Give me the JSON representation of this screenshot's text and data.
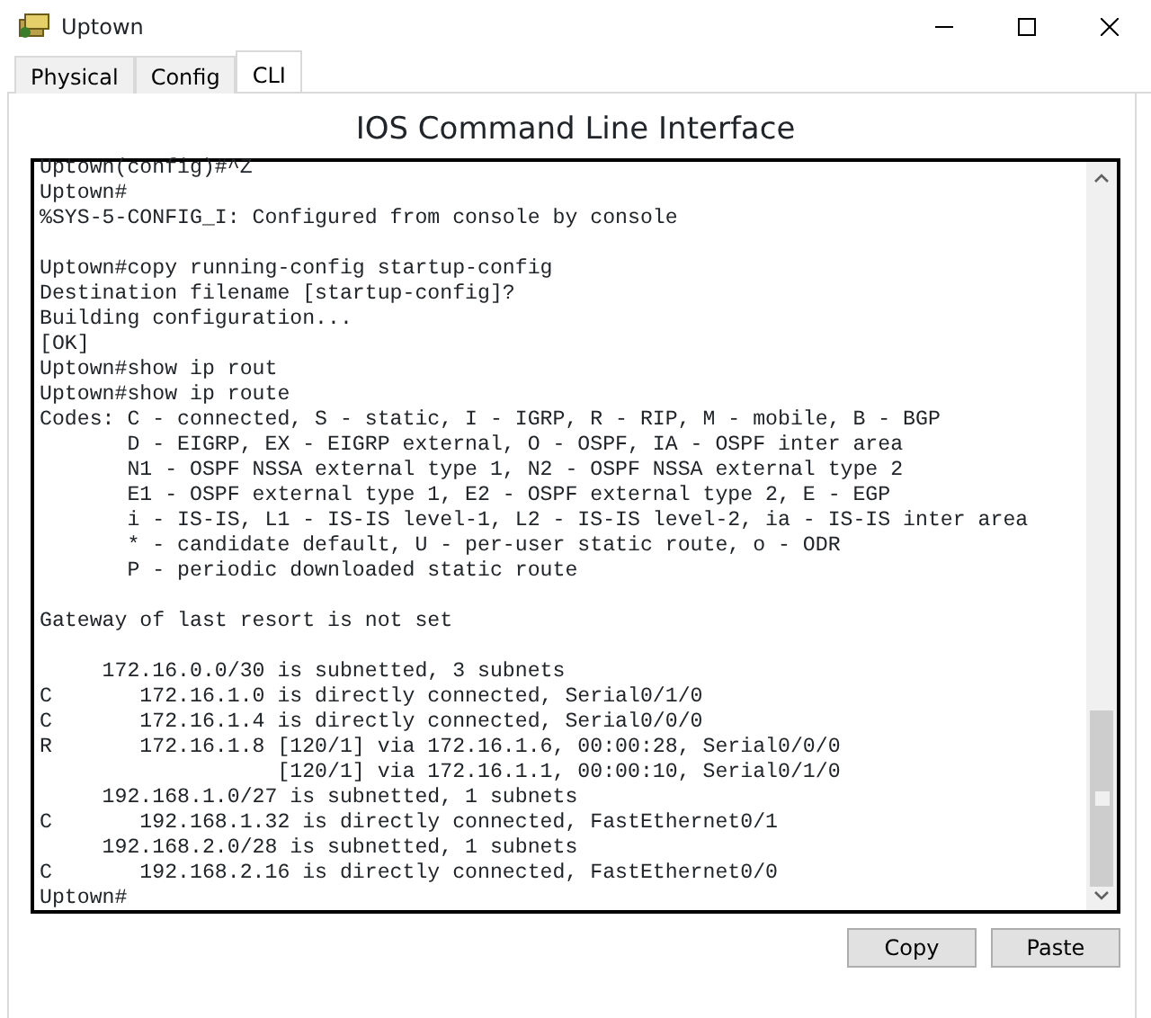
{
  "window": {
    "title": "Uptown"
  },
  "tabs": [
    {
      "label": "Physical",
      "selected": false
    },
    {
      "label": "Config",
      "selected": false
    },
    {
      "label": "CLI",
      "selected": true
    }
  ],
  "heading": "IOS Command Line Interface",
  "terminal": {
    "blocks": [
      [
        "Uptown(config)#^Z",
        "Uptown#",
        "%SYS-5-CONFIG_I: Configured from console by console"
      ],
      [
        "Uptown#copy running-config startup-config",
        "Destination filename [startup-config]?",
        "Building configuration...",
        "[OK]",
        "Uptown#show ip rout",
        "Uptown#show ip route",
        "Codes: C - connected, S - static, I - IGRP, R - RIP, M - mobile, B - BGP",
        "       D - EIGRP, EX - EIGRP external, O - OSPF, IA - OSPF inter area",
        "       N1 - OSPF NSSA external type 1, N2 - OSPF NSSA external type 2",
        "       E1 - OSPF external type 1, E2 - OSPF external type 2, E - EGP",
        "       i - IS-IS, L1 - IS-IS level-1, L2 - IS-IS level-2, ia - IS-IS inter area",
        "       * - candidate default, U - per-user static route, o - ODR",
        "       P - periodic downloaded static route"
      ],
      [
        "Gateway of last resort is not set"
      ],
      [
        "     172.16.0.0/30 is subnetted, 3 subnets",
        "C       172.16.1.0 is directly connected, Serial0/1/0",
        "C       172.16.1.4 is directly connected, Serial0/0/0",
        "R       172.16.1.8 [120/1] via 172.16.1.6, 00:00:28, Serial0/0/0",
        "                   [120/1] via 172.16.1.1, 00:00:10, Serial0/1/0",
        "     192.168.1.0/27 is subnetted, 1 subnets",
        "C       192.168.1.32 is directly connected, FastEthernet0/1",
        "     192.168.2.0/28 is subnetted, 1 subnets",
        "C       192.168.2.16 is directly connected, FastEthernet0/0",
        "Uptown#"
      ]
    ]
  },
  "buttons": [
    "Copy",
    "Paste"
  ]
}
